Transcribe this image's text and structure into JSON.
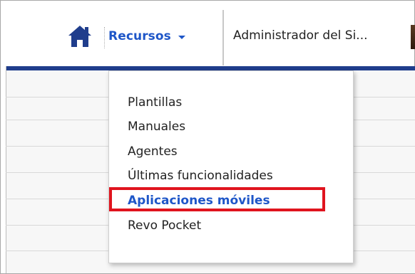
{
  "header": {
    "home_icon": "home-icon",
    "resources_label": "Recursos",
    "resources_caret_icon": "caret-down-icon",
    "user_name": "Administrador del Si..."
  },
  "dropdown": {
    "items": [
      {
        "label": "Plantillas",
        "active": false
      },
      {
        "label": "Manuales",
        "active": false
      },
      {
        "label": "Agentes",
        "active": false
      },
      {
        "label": "Últimas funcionalidades",
        "active": false
      },
      {
        "label": "Aplicaciones móviles",
        "active": true
      },
      {
        "label": "Revo Pocket",
        "active": false
      }
    ]
  },
  "colors": {
    "accent": "#1e56c8",
    "header_band": "#1f3d8c",
    "highlight": "#e0141e"
  }
}
